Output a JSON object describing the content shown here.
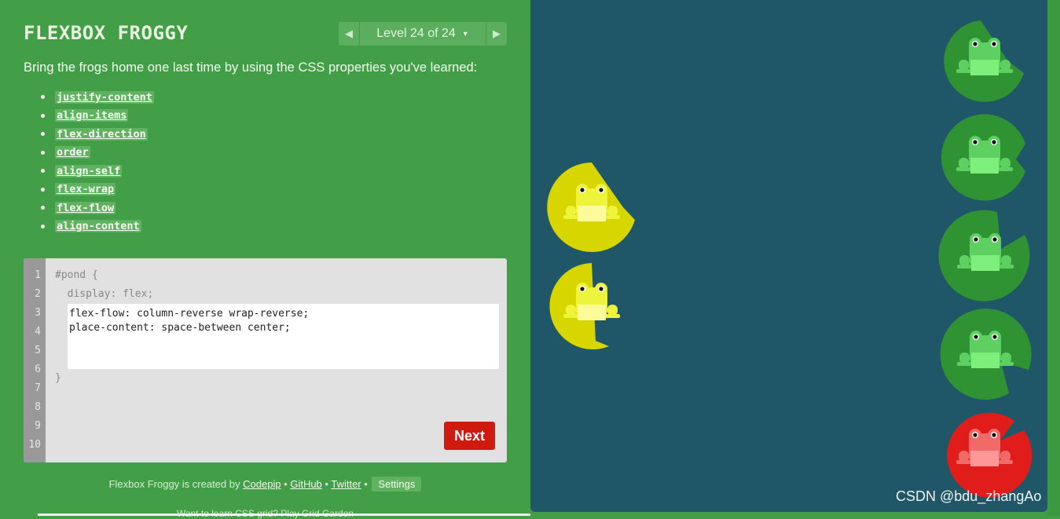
{
  "header": {
    "title": "FLEXBOX FROGGY",
    "level_label": "Level 24 of 24",
    "prev_icon": "left-triangle-icon",
    "next_icon": "right-triangle-icon",
    "caret_icon": "caret-down-icon"
  },
  "instructions": "Bring the frogs home one last time by using the CSS properties you've learned:",
  "properties": [
    "justify-content",
    "align-items",
    "flex-direction",
    "order",
    "align-self",
    "flex-wrap",
    "flex-flow",
    "align-content"
  ],
  "editor": {
    "line_numbers": [
      "1",
      "2",
      "3",
      "4",
      "5",
      "6",
      "7",
      "8",
      "9",
      "10"
    ],
    "line1": "#pond {",
    "line2": "  display: flex;",
    "input_value": "flex-flow: column-reverse wrap-reverse;\nplace-content: space-between center;",
    "closing": "}",
    "next_label": "Next"
  },
  "footer": {
    "prefix": "Flexbox Froggy is created by ",
    "codepip": "Codepip",
    "sep1": " • ",
    "github": "GitHub",
    "sep2": " • ",
    "twitter": "Twitter",
    "sep3": " • ",
    "settings": "Settings",
    "cutoff": "Want to learn CSS grid? Play Grid Garden"
  },
  "colors": {
    "sidebar_bg": "#439f47",
    "pond_bg": "#1f5768",
    "yellow_pad": "#d7d600",
    "green_pad": "#2f9233",
    "red_pad": "#e01d1a"
  },
  "watermark": "CSDN @bdu_zhangAo"
}
